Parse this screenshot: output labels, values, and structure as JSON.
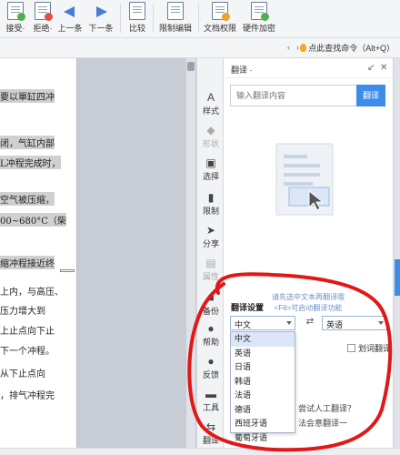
{
  "ribbon": {
    "buttons": [
      {
        "label": "接受·"
      },
      {
        "label": "拒绝·"
      },
      {
        "label": "上一条"
      },
      {
        "label": "下一条"
      },
      {
        "label": "比较"
      },
      {
        "label": "限制编辑"
      },
      {
        "label": "文档权限"
      },
      {
        "label": "硬件加密"
      }
    ],
    "command_search": "点此查找命令（Alt+Q）"
  },
  "document": {
    "lines": [
      {
        "text": "要以單缸四冲",
        "highlight": true
      },
      {
        "text": "闭，气缸内部",
        "highlight": true
      },
      {
        "text": "L冲程完成时，",
        "highlight": true
      },
      {
        "text": "空气被压缩，",
        "highlight": true
      },
      {
        "text": "00~680°C（柴",
        "highlight": true
      },
      {
        "text": "缩冲程接近终",
        "highlight": true
      },
      {
        "text": "上内，与高压、",
        "highlight": false
      },
      {
        "text": "压力增大到",
        "highlight": false
      },
      {
        "text": "上止点向下止",
        "highlight": false
      },
      {
        "text": "下一个冲程。",
        "highlight": false
      },
      {
        "text": "从下止点向",
        "highlight": false
      },
      {
        "text": "，排气冲程完",
        "highlight": false
      }
    ]
  },
  "side_tools": [
    {
      "label": "样式",
      "icon": "style-icon"
    },
    {
      "label": "形状",
      "icon": "shape-icon"
    },
    {
      "label": "选择",
      "icon": "select-icon"
    },
    {
      "label": "限制",
      "icon": "restrict-icon"
    },
    {
      "label": "分享",
      "icon": "share-icon"
    },
    {
      "label": "属性",
      "icon": "property-icon"
    },
    {
      "label": "备份",
      "icon": "backup-icon"
    },
    {
      "label": "帮助",
      "icon": "help-icon"
    },
    {
      "label": "反馈",
      "icon": "feedback-icon"
    },
    {
      "label": "工具",
      "icon": "tool-icon"
    },
    {
      "label": "翻译",
      "icon": "translate-icon"
    }
  ],
  "translate_panel": {
    "title": "翻译 ·",
    "input_placeholder": "输入翻译内容",
    "translate_button": "翻译",
    "hint_line1": "请先选中文本再翻译哦",
    "hint_line2": "<F6>可启动翻译功能",
    "settings_title": "翻译设置",
    "source_lang": "中文",
    "target_lang": "英语",
    "dropdown_options": [
      "中文",
      "英语",
      "日语",
      "韩语",
      "法语",
      "德语",
      "西班牙语",
      "葡萄牙语"
    ],
    "checkbox_label": "划词翻译",
    "human_translate": "尝试人工翻译？",
    "partial_line": "法会意翻译一"
  },
  "colors": {
    "accent": "#3c8ce8",
    "annotation": "#e01818"
  }
}
